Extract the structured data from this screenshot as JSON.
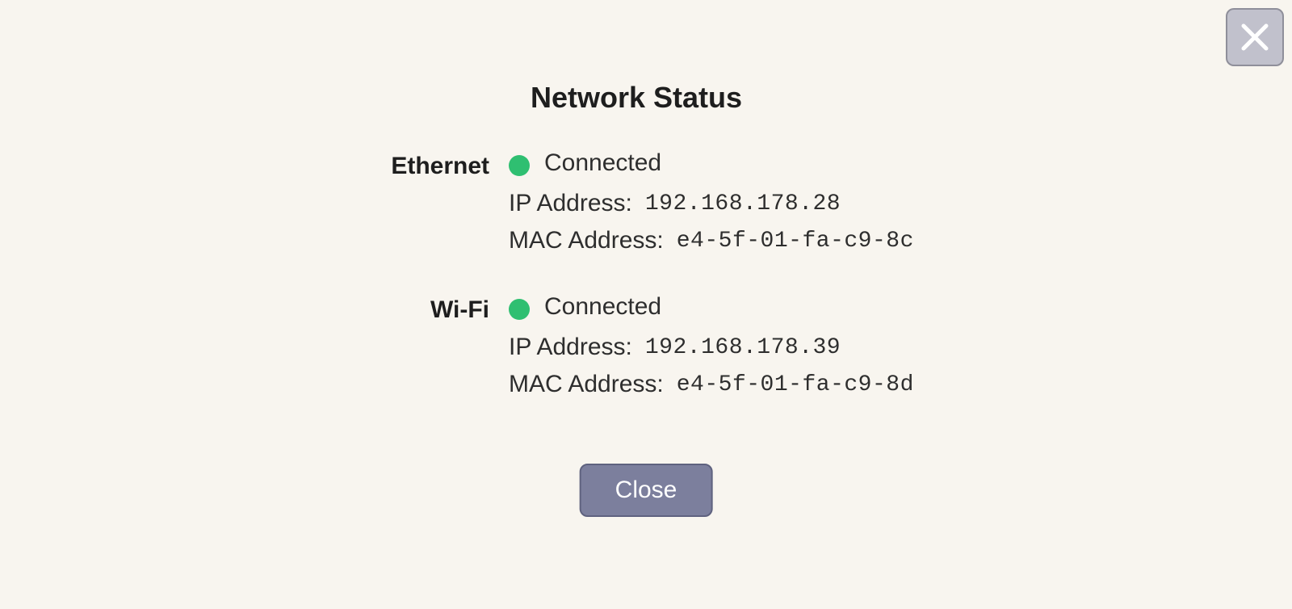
{
  "dialog": {
    "title": "Network Status",
    "close_label": "Close"
  },
  "labels": {
    "ip_address": "IP Address:",
    "mac_address": "MAC Address:"
  },
  "interfaces": [
    {
      "name": "Ethernet",
      "status": "Connected",
      "status_color": "#2fbf71",
      "ip": "192.168.178.28",
      "mac": "e4-5f-01-fa-c9-8c"
    },
    {
      "name": "Wi-Fi",
      "status": "Connected",
      "status_color": "#2fbf71",
      "ip": "192.168.178.39",
      "mac": "e4-5f-01-fa-c9-8d"
    }
  ]
}
